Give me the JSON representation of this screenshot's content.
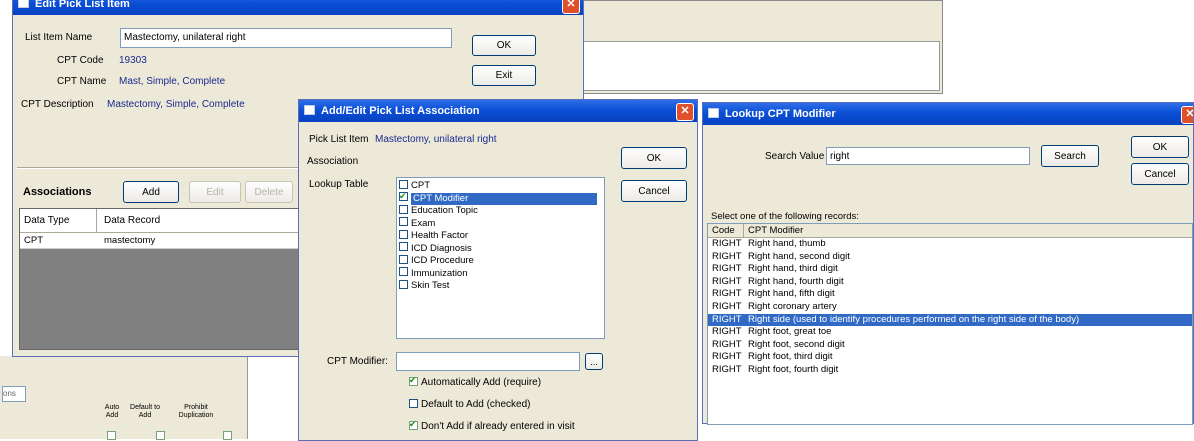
{
  "edit_pick_list_item": {
    "title": "Edit Pick List Item",
    "list_item_name_label": "List Item Name",
    "list_item_name_value": "Mastectomy, unilateral right",
    "ok_label": "OK",
    "exit_label": "Exit",
    "cpt_code_label": "CPT Code",
    "cpt_code_value": "19303",
    "cpt_name_label": "CPT Name",
    "cpt_name_value": "Mast, Simple, Complete",
    "cpt_description_label": "CPT Description",
    "cpt_description_value": "Mastectomy, Simple, Complete",
    "associations_label": "Associations",
    "add_label": "Add",
    "edit_label": "Edit",
    "delete_label": "Delete",
    "grid_headers": [
      "Data Type",
      "Data Record"
    ],
    "grid_rows": [
      [
        "CPT",
        "mastectomy"
      ]
    ]
  },
  "background_panel": {
    "headers": [
      "Auto Add",
      "Default to Add",
      "Prohibit Duplication"
    ],
    "fragment_text": "ons"
  },
  "add_edit_association": {
    "title": "Add/Edit Pick List Association",
    "pick_list_item_label": "Pick List Item",
    "pick_list_item_value": "Mastectomy, unilateral right",
    "association_group": "Association",
    "lookup_table_label": "Lookup Table",
    "lookup_items": [
      {
        "label": "CPT",
        "checked": false,
        "selected": false
      },
      {
        "label": "CPT Modifier",
        "checked": true,
        "selected": true
      },
      {
        "label": "Education Topic",
        "checked": false,
        "selected": false
      },
      {
        "label": "Exam",
        "checked": false,
        "selected": false
      },
      {
        "label": "Health Factor",
        "checked": false,
        "selected": false
      },
      {
        "label": "ICD Diagnosis",
        "checked": false,
        "selected": false
      },
      {
        "label": "ICD Procedure",
        "checked": false,
        "selected": false
      },
      {
        "label": "Immunization",
        "checked": false,
        "selected": false
      },
      {
        "label": "Skin Test",
        "checked": false,
        "selected": false
      }
    ],
    "cpt_modifier_label": "CPT Modifier:",
    "cpt_modifier_value": "",
    "browse_label": "...",
    "ok_label": "OK",
    "cancel_label": "Cancel",
    "options": [
      {
        "label": "Automatically Add (require)",
        "checked": true
      },
      {
        "label": "Default to Add (checked)",
        "checked": false
      },
      {
        "label": "Don't Add if already entered in visit",
        "checked": true
      }
    ]
  },
  "lookup_cpt_modifier": {
    "title": "Lookup CPT Modifier",
    "search_value_label": "Search Value",
    "search_value": "right",
    "search_label": "Search",
    "ok_label": "OK",
    "cancel_label": "Cancel",
    "instruction": "Select one of the following records:",
    "headers": [
      "Code",
      "CPT Modifier"
    ],
    "rows": [
      [
        "RIGHT",
        "Right hand, thumb"
      ],
      [
        "RIGHT",
        "Right hand, second digit"
      ],
      [
        "RIGHT",
        "Right hand, third digit"
      ],
      [
        "RIGHT",
        "Right hand, fourth digit"
      ],
      [
        "RIGHT",
        "Right hand, fifth digit"
      ],
      [
        "RIGHT",
        "Right coronary artery"
      ],
      [
        "RIGHT",
        "Right side (used to identify procedures performed on the right side of the body)"
      ],
      [
        "RIGHT",
        "Right foot, great toe"
      ],
      [
        "RIGHT",
        "Right foot, second digit"
      ],
      [
        "RIGHT",
        "Right foot, third digit"
      ],
      [
        "RIGHT",
        "Right foot, fourth digit"
      ]
    ],
    "selected_index": 6
  },
  "colors": {
    "title_bar": "#0a4fd6",
    "selection": "#316ac5",
    "value_text": "#1c2a90",
    "window_face": "#ece9d8"
  }
}
